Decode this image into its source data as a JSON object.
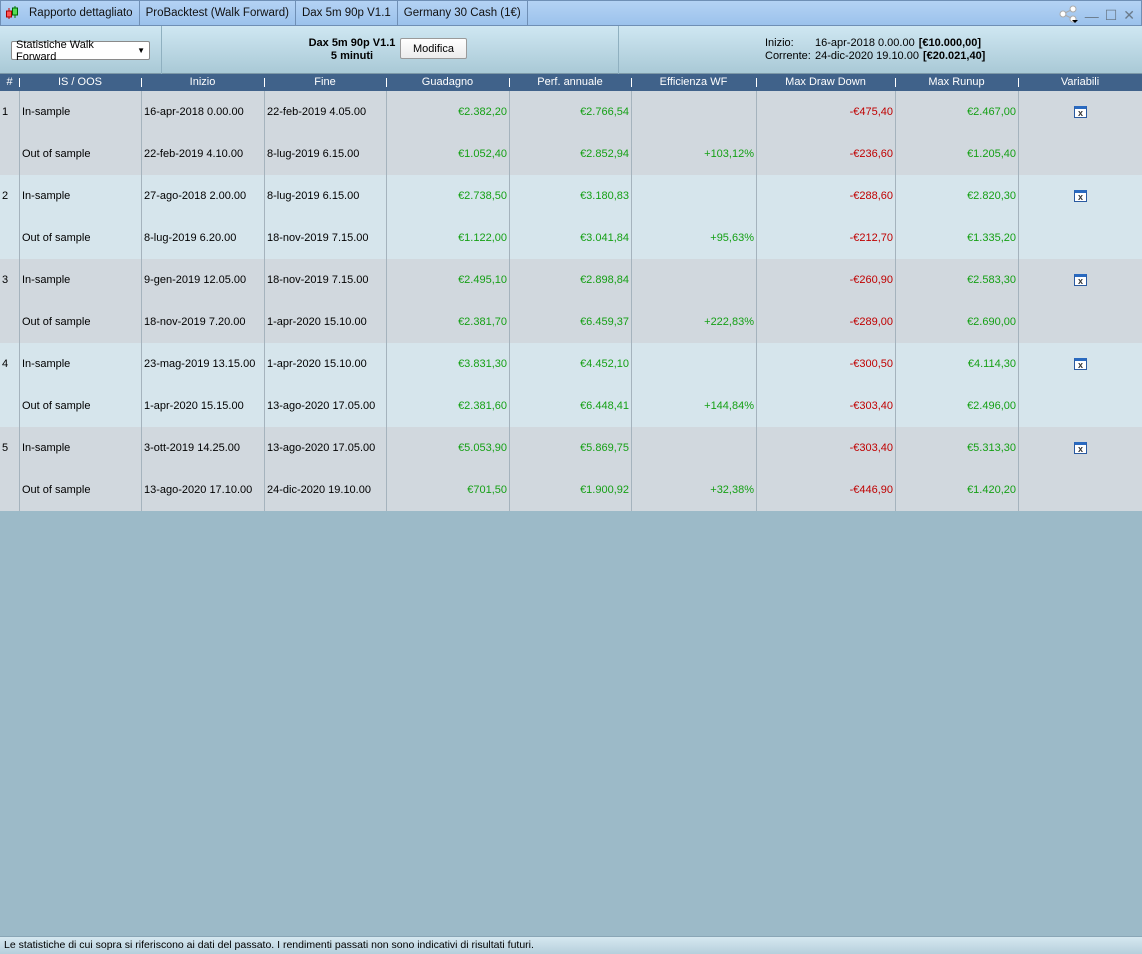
{
  "titlebar": {
    "tabs": [
      "Rapporto dettagliato",
      "ProBacktest (Walk Forward)",
      "Dax 5m 90p V1.1",
      "Germany 30 Cash (1€)"
    ]
  },
  "toolbar": {
    "view_select": "Statistiche Walk Forward",
    "strategy_name": "Dax 5m 90p V1.1",
    "timeframe": "5 minuti",
    "modifica_label": "Modifica",
    "start_label": "Inizio:",
    "start_date": "16-apr-2018 0.00.00",
    "start_capital": "[€10.000,00]",
    "current_label": "Corrente:",
    "current_date": "24-dic-2020 19.10.00",
    "current_capital": "[€20.021,40]"
  },
  "colors": {
    "positive": "#15a015",
    "negative": "#c00000",
    "header": "#40628a"
  },
  "table": {
    "headers": [
      "#",
      "IS / OOS",
      "Inizio",
      "Fine",
      "Guadagno",
      "Perf. annuale",
      "Efficienza WF",
      "Max Draw Down",
      "Max Runup",
      "Variabili"
    ],
    "groups": [
      {
        "n": "1",
        "rows": [
          {
            "type": "In-sample",
            "start": "16-apr-2018 0.00.00",
            "end": "22-feb-2019 4.05.00",
            "gain": "€2.382,20",
            "perf": "€2.766,54",
            "eff": "",
            "mdd": "-€475,40",
            "runup": "€2.467,00"
          },
          {
            "type": "Out of sample",
            "start": "22-feb-2019 4.10.00",
            "end": "8-lug-2019 6.15.00",
            "gain": "€1.052,40",
            "perf": "€2.852,94",
            "eff": "+103,12%",
            "mdd": "-€236,60",
            "runup": "€1.205,40"
          }
        ]
      },
      {
        "n": "2",
        "rows": [
          {
            "type": "In-sample",
            "start": "27-ago-2018 2.00.00",
            "end": "8-lug-2019 6.15.00",
            "gain": "€2.738,50",
            "perf": "€3.180,83",
            "eff": "",
            "mdd": "-€288,60",
            "runup": "€2.820,30"
          },
          {
            "type": "Out of sample",
            "start": "8-lug-2019 6.20.00",
            "end": "18-nov-2019 7.15.00",
            "gain": "€1.122,00",
            "perf": "€3.041,84",
            "eff": "+95,63%",
            "mdd": "-€212,70",
            "runup": "€1.335,20"
          }
        ]
      },
      {
        "n": "3",
        "rows": [
          {
            "type": "In-sample",
            "start": "9-gen-2019 12.05.00",
            "end": "18-nov-2019 7.15.00",
            "gain": "€2.495,10",
            "perf": "€2.898,84",
            "eff": "",
            "mdd": "-€260,90",
            "runup": "€2.583,30"
          },
          {
            "type": "Out of sample",
            "start": "18-nov-2019 7.20.00",
            "end": "1-apr-2020 15.10.00",
            "gain": "€2.381,70",
            "perf": "€6.459,37",
            "eff": "+222,83%",
            "mdd": "-€289,00",
            "runup": "€2.690,00"
          }
        ]
      },
      {
        "n": "4",
        "rows": [
          {
            "type": "In-sample",
            "start": "23-mag-2019 13.15.00",
            "end": "1-apr-2020 15.10.00",
            "gain": "€3.831,30",
            "perf": "€4.452,10",
            "eff": "",
            "mdd": "-€300,50",
            "runup": "€4.114,30"
          },
          {
            "type": "Out of sample",
            "start": "1-apr-2020 15.15.00",
            "end": "13-ago-2020 17.05.00",
            "gain": "€2.381,60",
            "perf": "€6.448,41",
            "eff": "+144,84%",
            "mdd": "-€303,40",
            "runup": "€2.496,00"
          }
        ]
      },
      {
        "n": "5",
        "rows": [
          {
            "type": "In-sample",
            "start": "3-ott-2019 14.25.00",
            "end": "13-ago-2020 17.05.00",
            "gain": "€5.053,90",
            "perf": "€5.869,75",
            "eff": "",
            "mdd": "-€303,40",
            "runup": "€5.313,30"
          },
          {
            "type": "Out of sample",
            "start": "13-ago-2020 17.10.00",
            "end": "24-dic-2020 19.10.00",
            "gain": "€701,50",
            "perf": "€1.900,92",
            "eff": "+32,38%",
            "mdd": "-€446,90",
            "runup": "€1.420,20"
          }
        ]
      }
    ]
  },
  "footer": "Le statistiche di cui sopra si riferiscono ai dati del passato. I rendimenti passati non sono indicativi di risultati futuri."
}
